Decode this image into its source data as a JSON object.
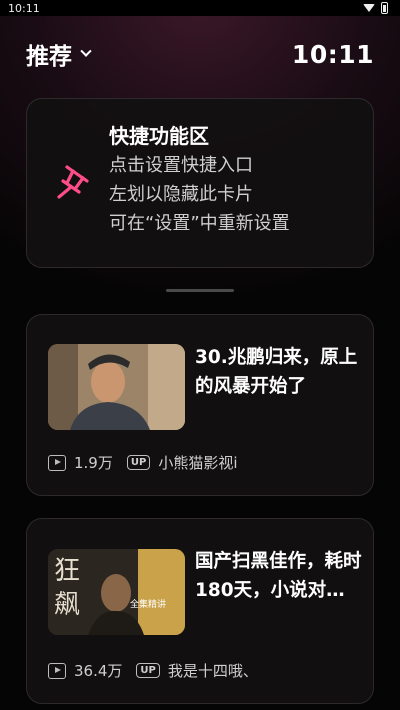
{
  "status_bar": {
    "time": "10:11"
  },
  "header": {
    "feed_label": "推荐",
    "clock": "10:11"
  },
  "shortcut_card": {
    "title": "快捷功能区",
    "lines": [
      "点击设置快捷入口",
      "左划以隐藏此卡片",
      "可在“设置”中重新设置"
    ],
    "icon": "pin-icon",
    "accent": "#ff4d8a"
  },
  "videos": [
    {
      "title": "30.兆鹏归来，原上的风暴开始了",
      "views": "1.9万",
      "uploader": "小熊猫影视i"
    },
    {
      "title": "国产扫黑佳作，耗时180天，小说对…",
      "views": "36.4万",
      "uploader": "我是十四哦、",
      "thumb_text": [
        "狂",
        "飙",
        "全集精讲"
      ]
    }
  ]
}
